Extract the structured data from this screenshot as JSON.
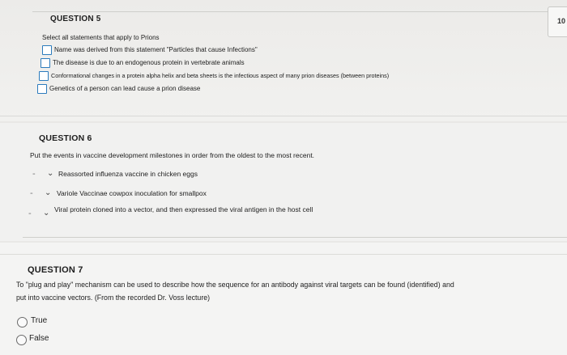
{
  "q5": {
    "title": "QUESTION 5",
    "points": "10",
    "prompt": "Select all statements that apply to Prions",
    "options": [
      "Name was derived from this statement \"Particles that cause Infections\"",
      "The disease is due to an endogenous protein in vertebrate animals",
      "Conformational changes in a protein alpha helix and beta sheets is the infectious aspect of many prion diseases (between proteins)",
      "Genetics of a person can lead cause a prion disease"
    ]
  },
  "q6": {
    "title": "QUESTION 6",
    "prompt": "Put the events in vaccine development milestones in order from the oldest to the most recent.",
    "items": [
      {
        "value": "-",
        "label": "Reassorted influenza vaccine in chicken eggs"
      },
      {
        "value": "-",
        "label": "Variole Vaccinae cowpox inoculation for smallpox"
      },
      {
        "value": "-",
        "label": "Viral protein cloned into a vector, and then expressed the viral antigen in the host cell"
      }
    ]
  },
  "q7": {
    "title": "QUESTION 7",
    "prompt_line1": "To \"plug and play\" mechanism can be used to describe how the sequence for an antibody against viral targets can be found (identified) and",
    "prompt_line2": "put into vaccine vectors.  (From the recorded Dr. Voss lecture)",
    "options": [
      "True",
      "False"
    ]
  }
}
